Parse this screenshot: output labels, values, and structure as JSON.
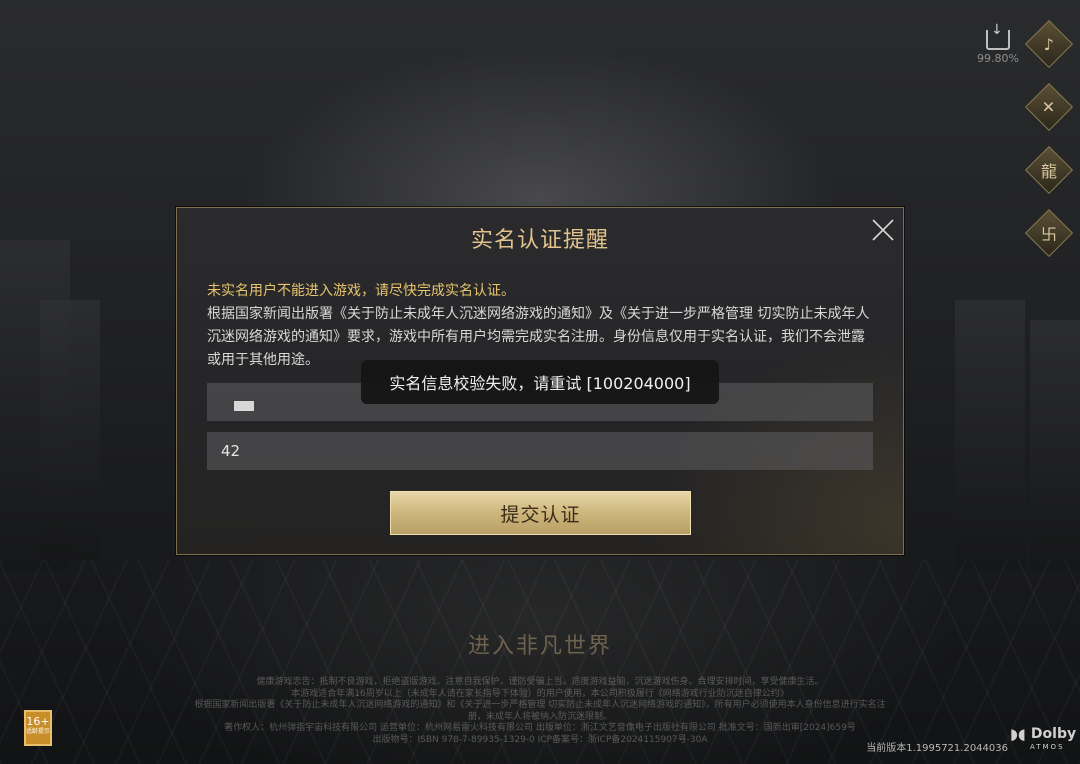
{
  "side_panel": {
    "download_percent": "99.80%",
    "icons": [
      "music-icon",
      "wrench-icon",
      "dragon-icon",
      "scroll-icon"
    ]
  },
  "modal": {
    "title": "实名认证提醒",
    "warning": "未实名用户不能进入游戏，请尽快完成实名认证。",
    "description": "根据国家新闻出版署《关于防止未成年人沉迷网络游戏的通知》及《关于进一步严格管理 切实防止未成年人沉迷网络游戏的通知》要求，游戏中所有用户均需完成实名注册。身份信息仅用于实名认证，我们不会泄露或用于其他用途。",
    "name_field_value": "",
    "id_field_value": "42",
    "submit_label": "提交认证"
  },
  "toast": {
    "message": "实名信息校验失败，请重试 [100204000]"
  },
  "background": {
    "enter_world": "进入非凡世界"
  },
  "footer": {
    "legal_lines": [
      "健康游戏忠告：抵制不良游戏，拒绝盗版游戏。注意自我保护，谨防受骗上当。适度游戏益脑，沉迷游戏伤身。合理安排时间，享受健康生活。",
      "本游戏适合年满16周岁以上（未成年人请在家长指导下体验）的用户使用，本公司积极履行《网络游戏行业防沉迷自律公约》",
      "根据国家新闻出版署《关于防止未成年人沉迷网络游戏的通知》和《关于进一步严格管理 切实防止未成年人沉迷网络游戏的通知》，所有用户必须使用本人身份信息进行实名注册，未成年人将被纳入防沉迷限制。",
      "著作权人：杭州弹指宇宙科技有限公司  运营单位：杭州网易雷火科技有限公司  出版单位：浙江文艺音像电子出版社有限公司  批准文号：国新出审[2024]659号",
      "出版物号：ISBN 978-7-89935-1329-0  ICP备案号：浙ICP备2024115907号-30A"
    ],
    "age_rating": "16+",
    "age_rating_sub": "适龄提示",
    "version": "当前版本1.1995721.2044036",
    "dolby_text": "Dolby",
    "dolby_sub": "ATMOS"
  }
}
